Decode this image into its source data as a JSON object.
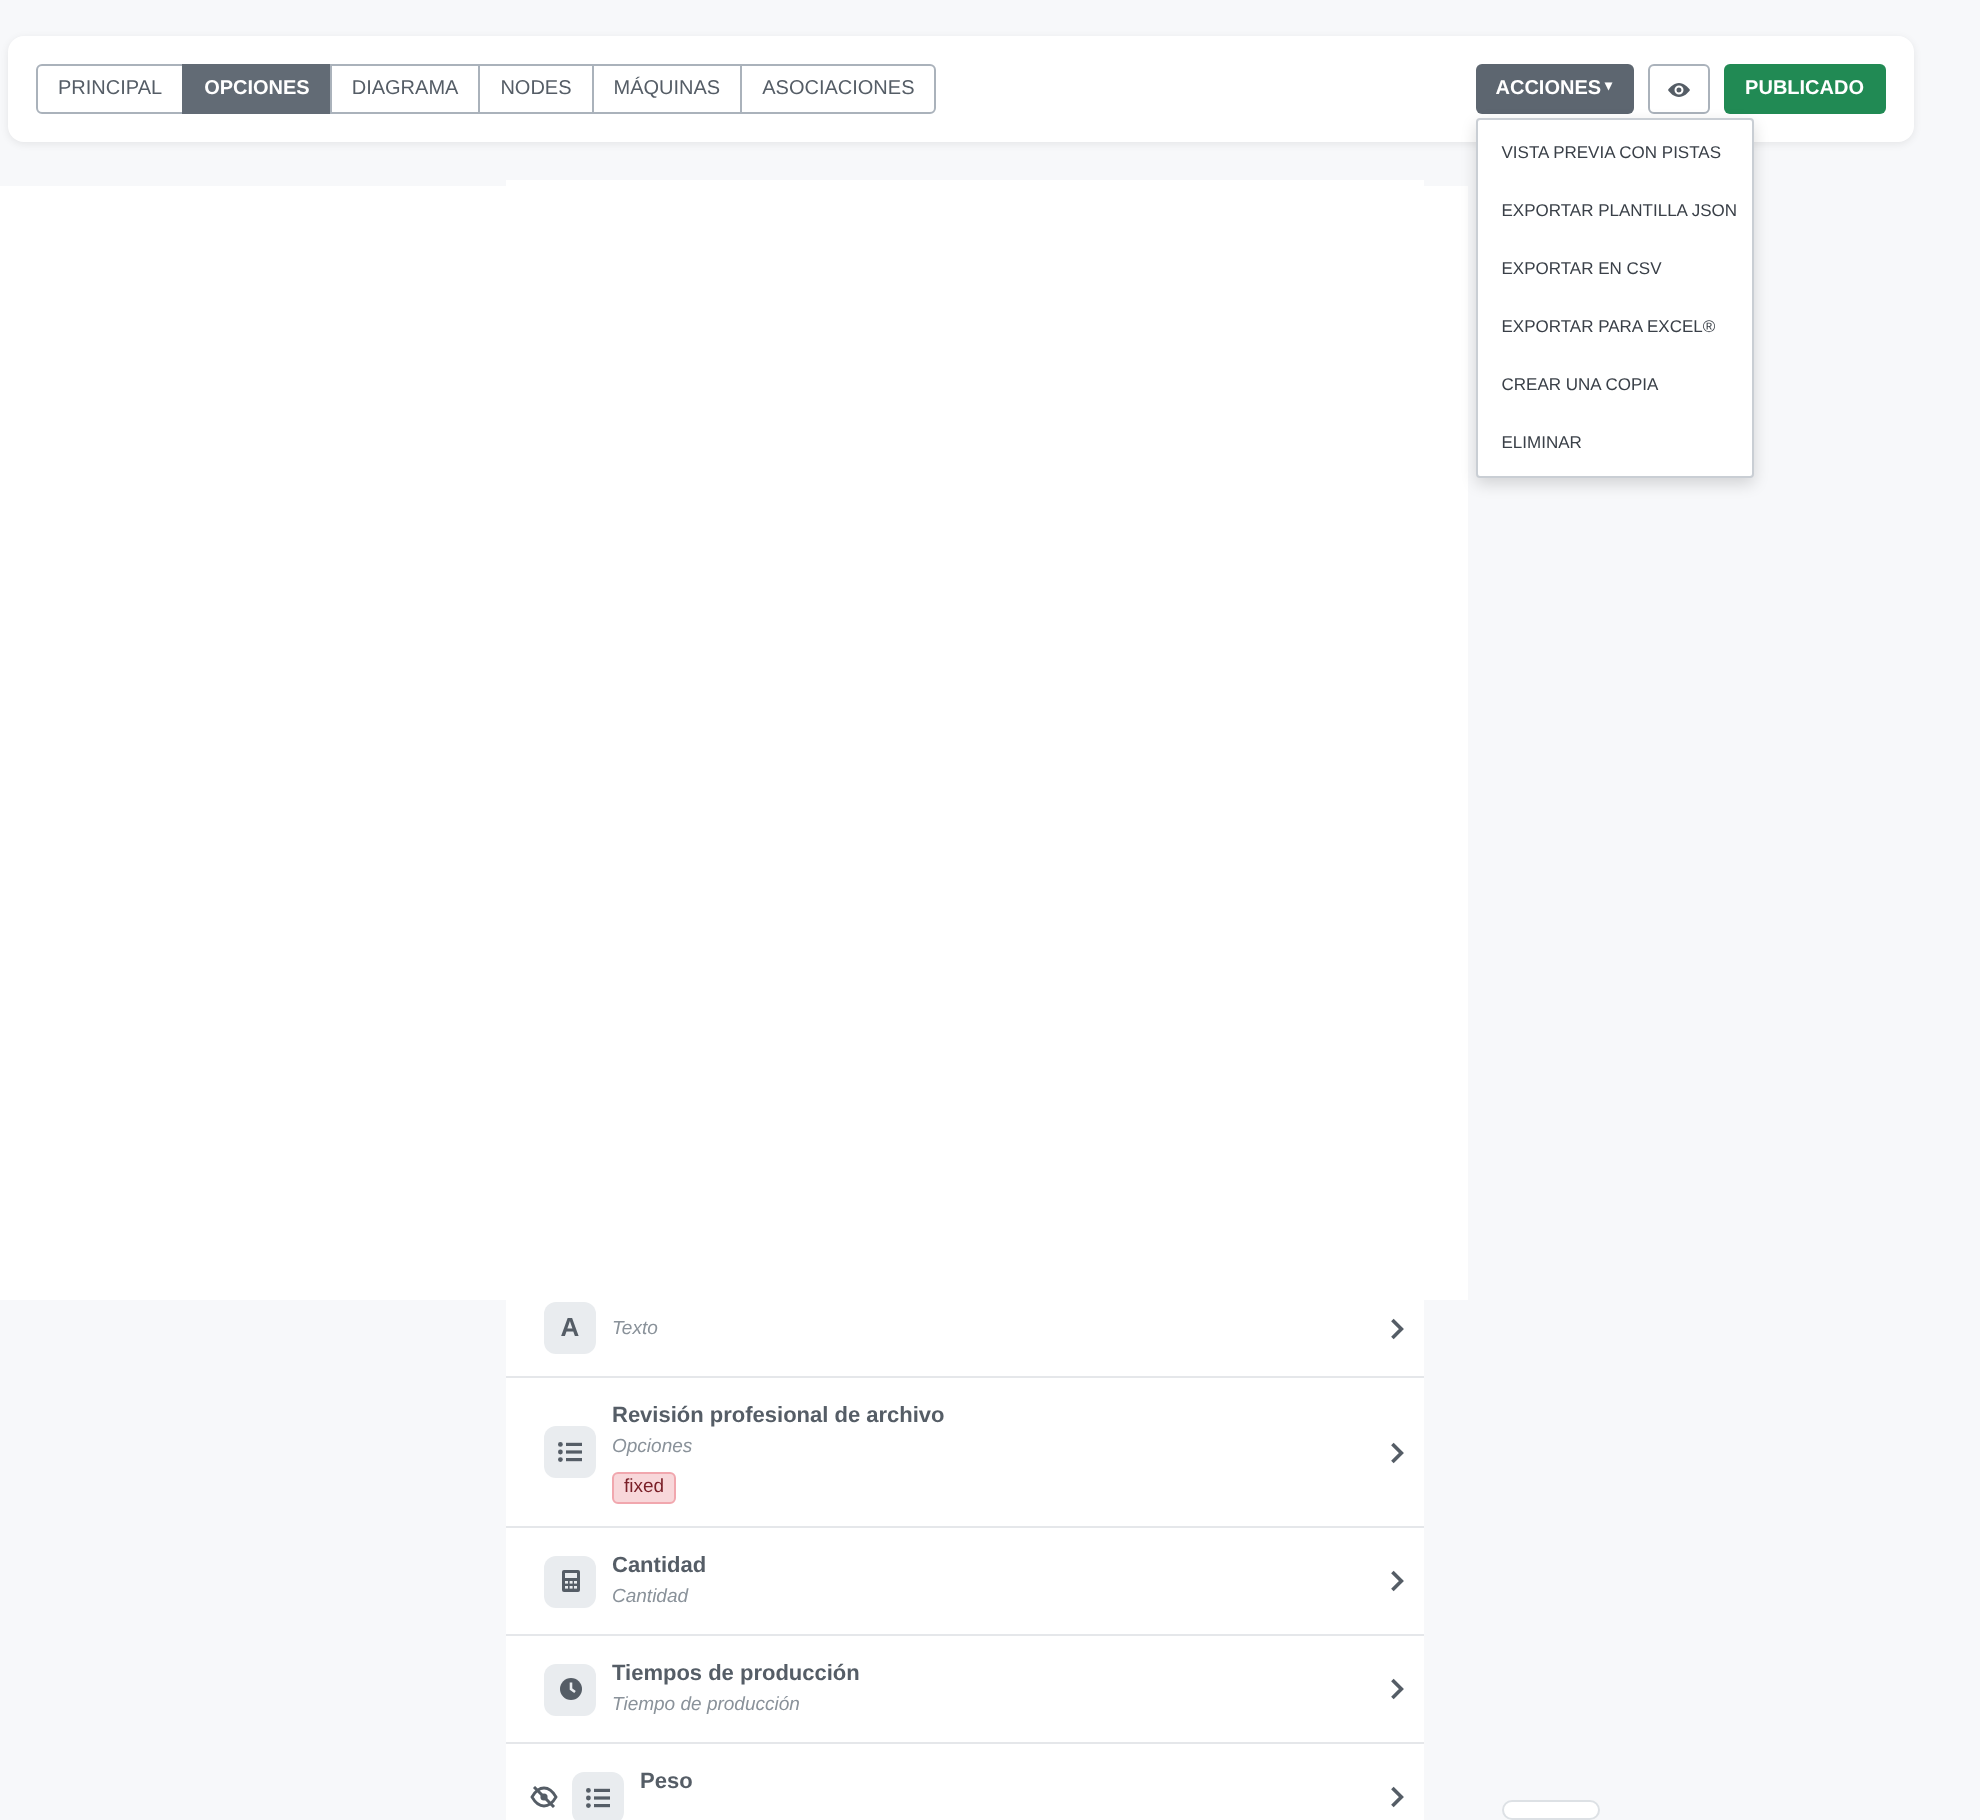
{
  "tabs": [
    {
      "label": "PRINCIPAL",
      "selected": false
    },
    {
      "label": "OPCIONES",
      "selected": true
    },
    {
      "label": "DIAGRAMA",
      "selected": false
    },
    {
      "label": "NODES",
      "selected": false
    },
    {
      "label": "MÁQUINAS",
      "selected": false
    },
    {
      "label": "ASOCIACIONES",
      "selected": false
    }
  ],
  "actions_button": {
    "label": "ACCIONES",
    "caret": "▾",
    "expanded": true
  },
  "publish_button": {
    "label": "PUBLICADO"
  },
  "actions_menu": [
    {
      "label": "VISTA PREVIA CON PISTAS"
    },
    {
      "label": "EXPORTAR PLANTILLA JSON"
    },
    {
      "label": "EXPORTAR EN CSV"
    },
    {
      "label": "EXPORTAR PARA EXCEL®"
    },
    {
      "label": "CREAR UNA COPIA"
    },
    {
      "label": "ELIMINAR"
    }
  ],
  "fields": [
    {
      "kind": "text",
      "glyph": "A",
      "subtitle": "Texto",
      "hidden": false
    },
    {
      "kind": "options",
      "title": "Revisión profesional de archivo",
      "subtitle": "Opciones",
      "badge": "fixed",
      "hidden": false
    },
    {
      "kind": "quantity",
      "title": "Cantidad",
      "subtitle": "Cantidad",
      "hidden": false
    },
    {
      "kind": "time",
      "title": "Tiempos de producción",
      "subtitle": "Tiempo de producción",
      "hidden": false
    },
    {
      "kind": "options",
      "title": "Peso",
      "hidden": true
    }
  ]
}
